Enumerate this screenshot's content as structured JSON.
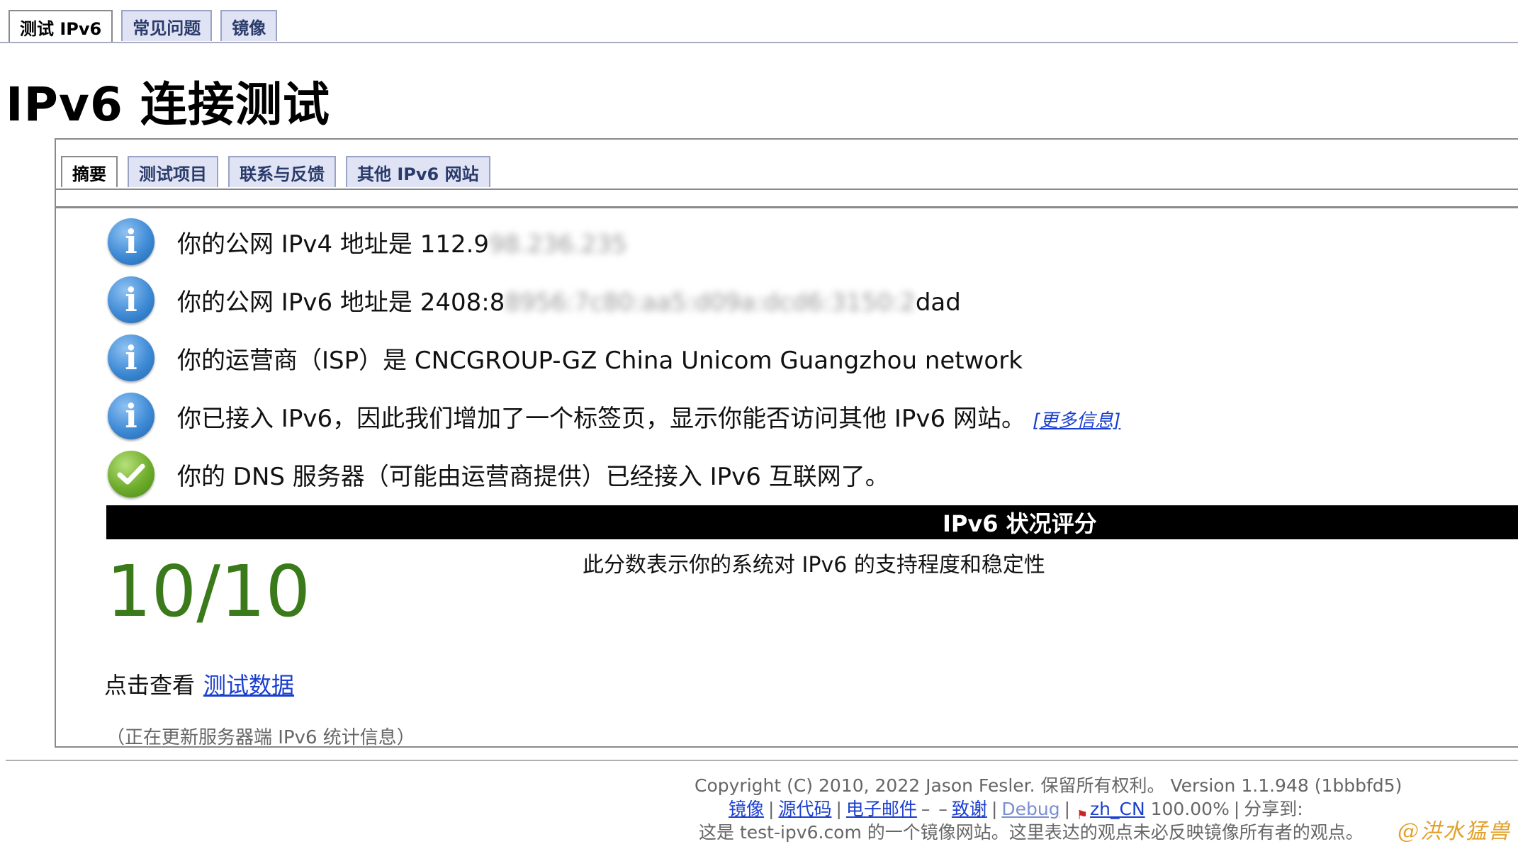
{
  "top_tabs": [
    {
      "label": "测试 IPv6",
      "active": true
    },
    {
      "label": "常见问题",
      "active": false
    },
    {
      "label": "镜像",
      "active": false
    }
  ],
  "page_title": "IPv6 连接测试",
  "inner_tabs": [
    {
      "label": "摘要",
      "active": true
    },
    {
      "label": "测试项目",
      "active": false
    },
    {
      "label": "联系与反馈",
      "active": false
    },
    {
      "label": "其他 IPv6 网站",
      "active": false
    }
  ],
  "rows": [
    {
      "icon": "info-icon",
      "prefix": "你的公网 IPv4 地址是 112.9",
      "redacted": "98.236.235",
      "suffix": ""
    },
    {
      "icon": "info-icon",
      "prefix": "你的公网 IPv6 地址是 2408:8",
      "redacted": "8956:7c80:aa5:d09a:dcd6:3150:2",
      "suffix": "dad"
    },
    {
      "icon": "info-icon",
      "prefix": "你的运营商（ISP）是 CNCGROUP-GZ China Unicom Guangzhou network",
      "redacted": "",
      "suffix": ""
    },
    {
      "icon": "info-icon",
      "prefix": "你已接入 IPv6，因此我们增加了一个标签页，显示你能否访问其他 IPv6 网站。",
      "redacted": "",
      "suffix": "",
      "link": "[更多信息]"
    },
    {
      "icon": "check-icon",
      "prefix": "你的 DNS 服务器（可能由运营商提供）已经接入 IPv6 互联网了。",
      "redacted": "",
      "suffix": ""
    }
  ],
  "score": {
    "bar_title": "IPv6 状况评分",
    "description": "此分数表示你的系统对 IPv6 的支持程度和稳定性",
    "value": "10/10",
    "color": "#3b7a1a"
  },
  "test_data": {
    "prefix": "点击查看",
    "link": "测试数据"
  },
  "update_note": "（正在更新服务器端 IPv6 统计信息）",
  "footer": {
    "copyright": "Copyright (C) 2010, 2022 Jason Fesler. 保留所有权利。 Version 1.1.948 (1bbbfd5)",
    "links": {
      "mirror": "镜像",
      "source": "源代码",
      "email": "电子邮件",
      "dash": "–",
      "dash2": "–",
      "thanks": "致谢",
      "debug": "Debug",
      "locale": "zh_CN",
      "percent": "100.00%",
      "share": "分享到:"
    },
    "mirror_note": "这是 test-ipv6.com 的一个镜像网站。这里表达的观点未必反映镜像所有者的观点。"
  },
  "watermark": "@洪水猛兽"
}
